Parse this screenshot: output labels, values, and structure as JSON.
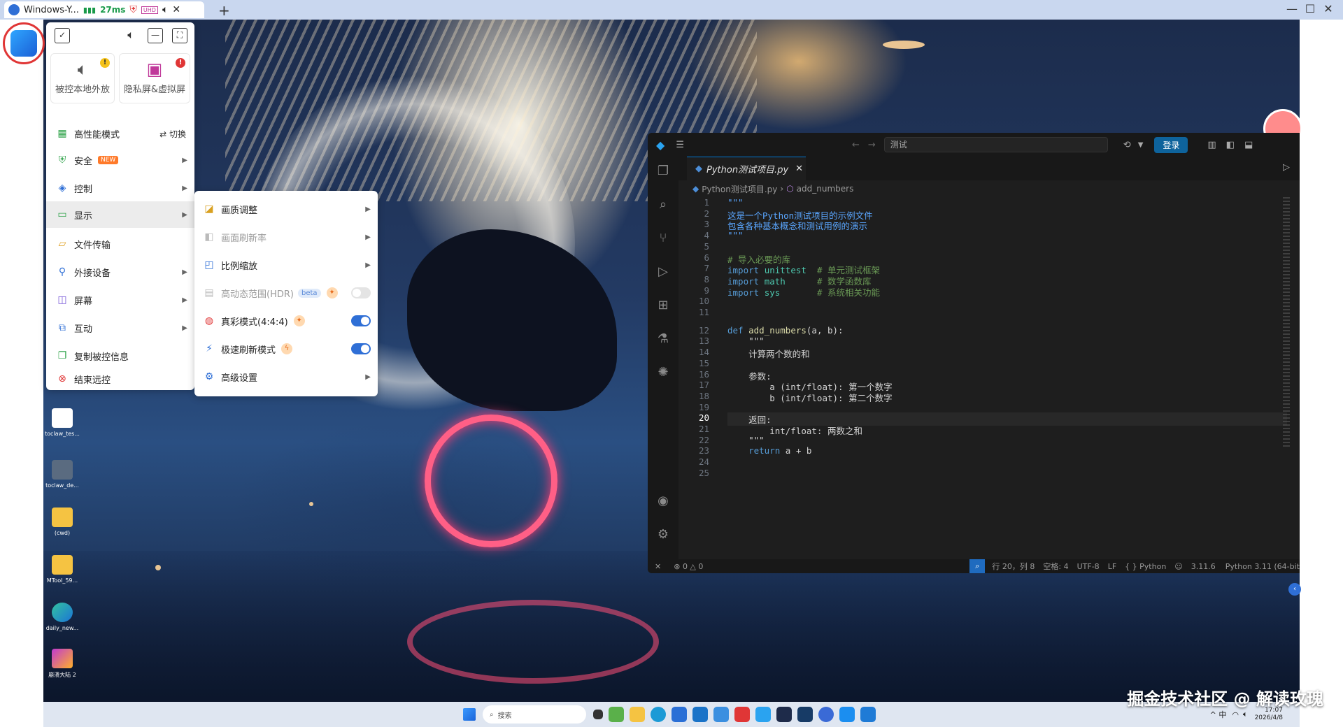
{
  "top_bar": {
    "tab_title": "Windows-Y...",
    "latency": "27ms",
    "icons": [
      "user-icon",
      "signal-icon",
      "shield-icon",
      "uhd-icon",
      "speaker-icon",
      "close-icon",
      "new-tab-icon"
    ]
  },
  "window_controls": {
    "minimize": "—",
    "maximize": "☐",
    "close": "✕"
  },
  "toolbar": {
    "top_icons": [
      "screen-check-icon",
      "volume-icon",
      "minimize-icon",
      "fullscreen-icon"
    ],
    "big_buttons": [
      {
        "label": "被控本地外放",
        "icon": "speaker-icon",
        "badge": "!"
      },
      {
        "label": "隐私屏&虚拟屏",
        "icon": "privacy-screen-icon",
        "badge": "!"
      }
    ],
    "performance": {
      "label": "高性能模式",
      "switch_label": "切换"
    },
    "menu": [
      {
        "label": "安全",
        "badge": "NEW",
        "arrow": true
      },
      {
        "label": "控制",
        "arrow": true
      },
      {
        "label": "显示",
        "arrow": true,
        "selected": true
      },
      {
        "label": "文件传输",
        "arrow": false
      },
      {
        "label": "外接设备",
        "arrow": true
      },
      {
        "label": "屏幕",
        "arrow": true
      },
      {
        "label": "互动",
        "arrow": true
      },
      {
        "label": "复制被控信息",
        "arrow": false
      },
      {
        "label": "结束远控",
        "arrow": false
      }
    ]
  },
  "display_submenu": [
    {
      "label": "画质调整",
      "type": "arrow",
      "disabled": false
    },
    {
      "label": "画面刷新率",
      "type": "arrow",
      "disabled": true
    },
    {
      "label": "比例缩放",
      "type": "arrow",
      "disabled": false
    },
    {
      "label": "高动态范围(HDR)",
      "badge": "beta",
      "type": "toggle",
      "on": false,
      "disabled": true
    },
    {
      "label": "真彩模式(4:4:4)",
      "type": "toggle",
      "on": true,
      "disabled": false
    },
    {
      "label": "极速刷新模式",
      "type": "toggle",
      "on": true,
      "disabled": false
    },
    {
      "label": "高级设置",
      "type": "arrow",
      "disabled": false
    }
  ],
  "desktop_icons": [
    {
      "label": "toclaw_tes..."
    },
    {
      "label": "toclaw_de..."
    },
    {
      "label": "(cwd)"
    },
    {
      "label": "MTool_59..."
    },
    {
      "label": "daily_new..."
    },
    {
      "label": "崩溃大陆 2"
    }
  ],
  "vscode": {
    "search_text": "测试",
    "login_label": "登录",
    "tab_name": "Python测试项目.py",
    "breadcrumb_file": "Python测试项目.py",
    "breadcrumb_symbol": "add_numbers",
    "code_lines": [
      {
        "n": "1",
        "t": "\"\"\""
      },
      {
        "n": "2",
        "t": "这是一个Python测试项目的示例文件"
      },
      {
        "n": "3",
        "t": "包含各种基本概念和测试用例的演示"
      },
      {
        "n": "4",
        "t": "\"\"\""
      },
      {
        "n": "5",
        "t": ""
      },
      {
        "n": "6",
        "t": "# 导入必要的库"
      },
      {
        "n": "7",
        "t": "import unittest  # 单元测试框架"
      },
      {
        "n": "8",
        "t": "import math      # 数学函数库"
      },
      {
        "n": "9",
        "t": "import sys       # 系统相关功能"
      },
      {
        "n": "10",
        "t": ""
      },
      {
        "n": "11",
        "t": ""
      },
      {
        "n": "12",
        "t": "def add_numbers(a, b):"
      },
      {
        "n": "13",
        "t": "    \"\"\""
      },
      {
        "n": "14",
        "t": "    计算两个数的和"
      },
      {
        "n": "15",
        "t": ""
      },
      {
        "n": "16",
        "t": "    参数:"
      },
      {
        "n": "17",
        "t": "        a (int/float): 第一个数字"
      },
      {
        "n": "18",
        "t": "        b (int/float): 第二个数字"
      },
      {
        "n": "19",
        "t": ""
      },
      {
        "n": "20",
        "t": "    返回:"
      },
      {
        "n": "21",
        "t": "        int/float: 两数之和"
      },
      {
        "n": "22",
        "t": "    \"\"\""
      },
      {
        "n": "23",
        "t": "    return a + b"
      },
      {
        "n": "24",
        "t": ""
      },
      {
        "n": "25",
        "t": ""
      }
    ],
    "status": {
      "errors": "0",
      "warnings": "0",
      "position": "行 20，列 8",
      "spaces": "空格: 4",
      "encoding": "UTF-8",
      "eol": "LF",
      "language": "Python",
      "version": "3.11.6",
      "interpreter": "Python 3.11 (64-bit"
    }
  },
  "taskbar": {
    "search_placeholder": "搜索",
    "tray": "^ 中",
    "time": "17:07",
    "date": "2026/4/8"
  },
  "watermark": "掘金技术社区 @ 解读玫瑰"
}
